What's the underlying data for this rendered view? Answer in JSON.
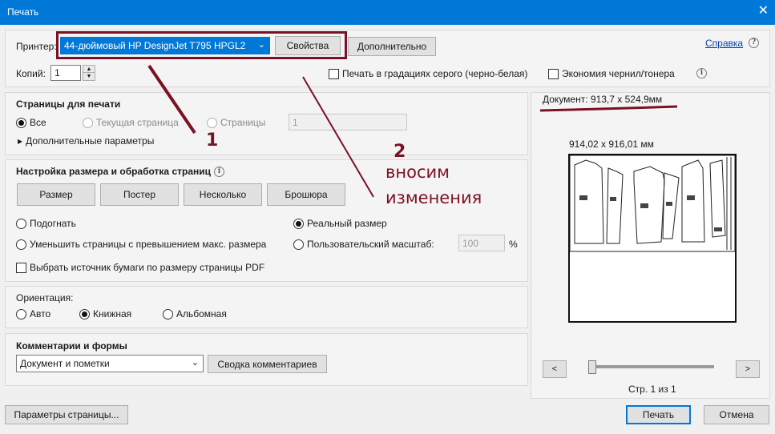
{
  "window": {
    "title": "Печать",
    "close_icon": "close-icon"
  },
  "printer": {
    "label": "Принтер:",
    "selected": "44-дюймовый HP DesignJet T795 HPGL2",
    "properties_button": "Свойства",
    "advanced_button": "Дополнительно",
    "help_link": "Справка"
  },
  "copies": {
    "label": "Копий:",
    "value": "1"
  },
  "options": {
    "grayscale": "Печать в градациях серого (черно-белая)",
    "save_ink": "Экономия чернил/тонера"
  },
  "pages": {
    "title": "Страницы для печати",
    "all": "Все",
    "current": "Текущая страница",
    "range": "Страницы",
    "range_value": "1",
    "more_options": "Дополнительные параметры"
  },
  "sizing": {
    "title": "Настройка размера и обработка страниц",
    "tabs": [
      "Размер",
      "Постер",
      "Несколько",
      "Брошюра"
    ],
    "fit": "Подогнать",
    "actual": "Реальный размер",
    "shrink": "Уменьшить страницы с превышением макс. размера",
    "custom": "Пользовательский масштаб:",
    "custom_value": "100",
    "percent": "%",
    "paper_source": "Выбрать источник бумаги по размеру страницы PDF"
  },
  "orientation": {
    "title": "Ориентация:",
    "auto": "Авто",
    "portrait": "Книжная",
    "landscape": "Альбомная"
  },
  "comments": {
    "title": "Комментарии и формы",
    "selected": "Документ и пометки",
    "summary_button": "Сводка комментариев"
  },
  "preview": {
    "document_size": "Документ: 913,7 x 524,9мм",
    "page_size": "914,02 x 916,01 мм",
    "prev": "<",
    "next": ">",
    "page_counter": "Стр. 1 из 1",
    "slider_value": 0
  },
  "footer": {
    "page_setup": "Параметры страницы...",
    "print": "Печать",
    "cancel": "Отмена"
  },
  "annotations": {
    "marker_1": "1",
    "marker_2": "2",
    "note_line1": "вносим",
    "note_line2": "изменения",
    "color": "#7a1225"
  }
}
